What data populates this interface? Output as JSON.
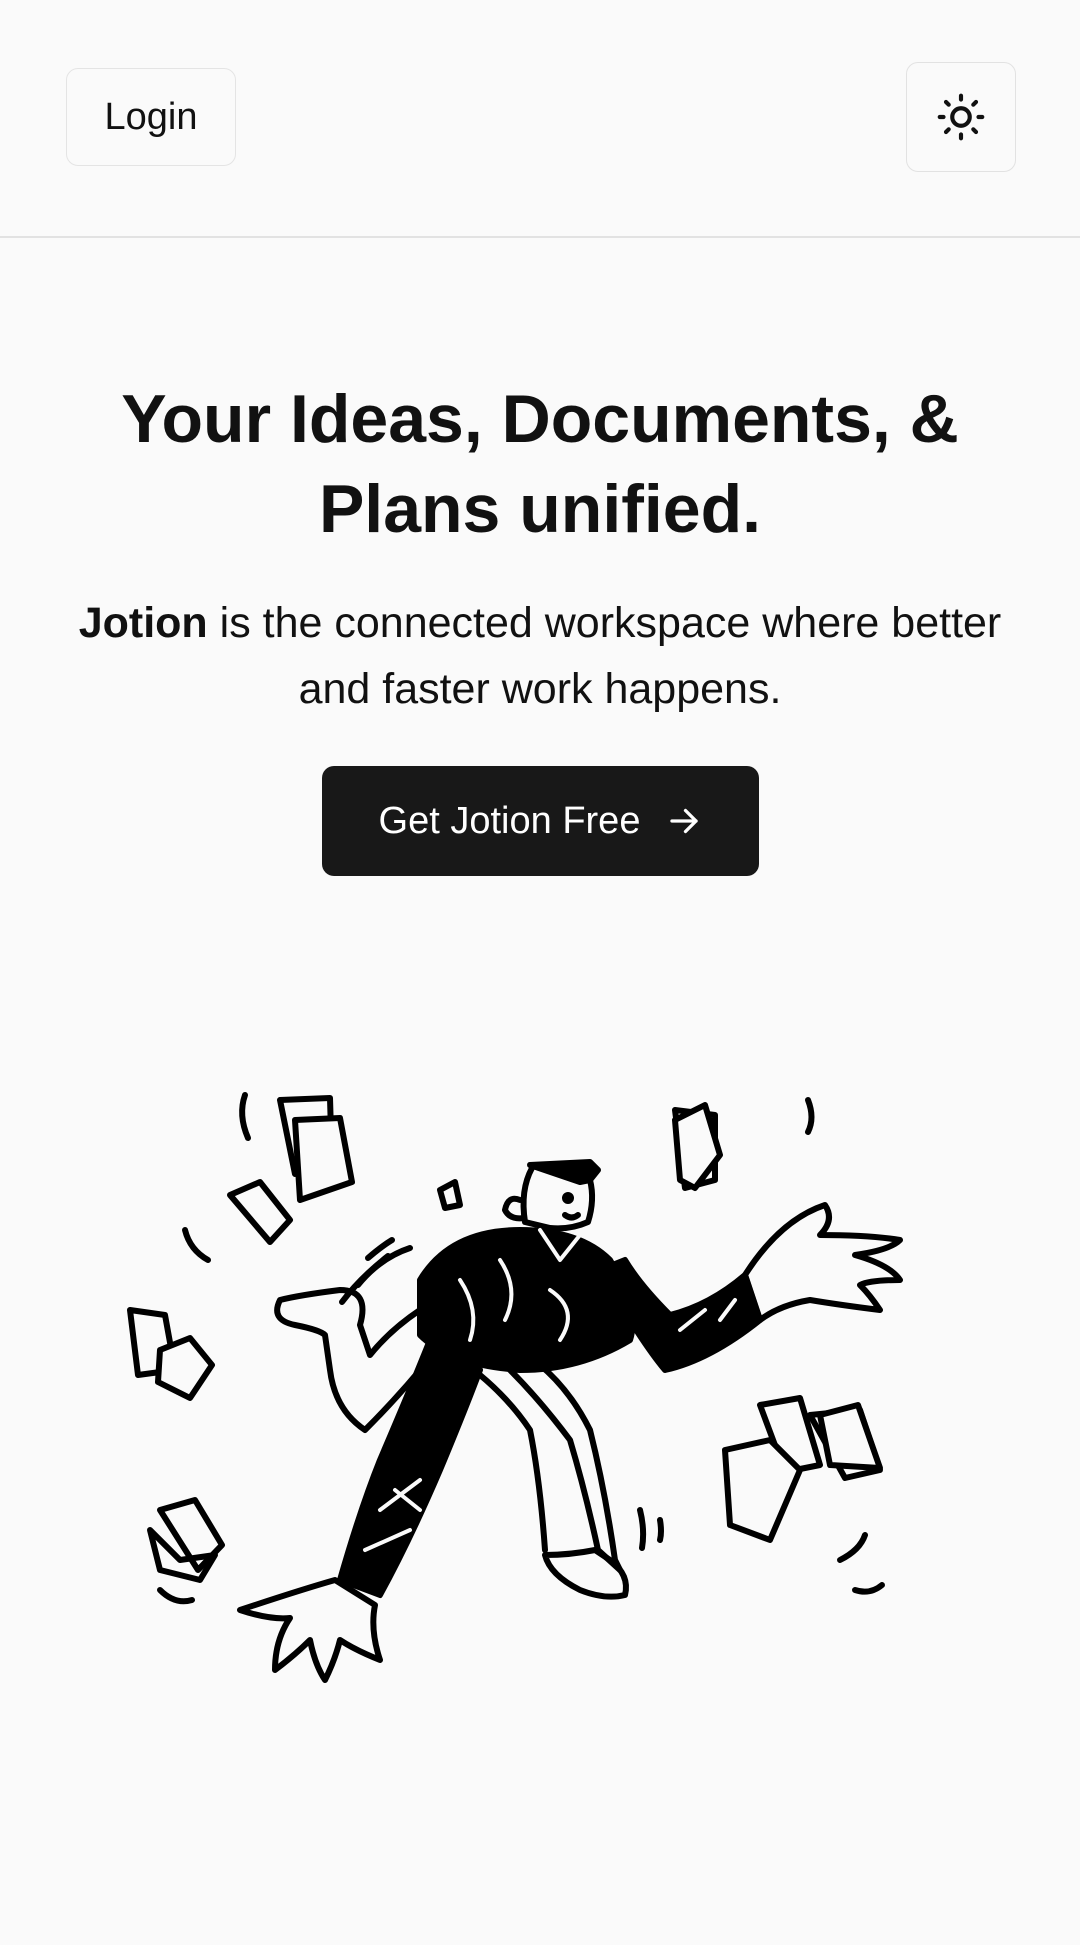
{
  "header": {
    "login_label": "Login",
    "theme_toggle_icon": "sun-icon"
  },
  "hero": {
    "headline": "Your Ideas, Documents, & Plans unified.",
    "subline_brand": "Jotion",
    "subline_rest": " is the connected workspace where better and faster work happens.",
    "cta_label": "Get Jotion Free",
    "cta_icon": "arrow-right-icon"
  },
  "illustration": {
    "icon": "person-juggling-documents-illustration"
  },
  "colors": {
    "background": "#fafafa",
    "text": "#111111",
    "cta_background": "#181818",
    "cta_text": "#ffffff",
    "border": "#e2e2e2"
  }
}
